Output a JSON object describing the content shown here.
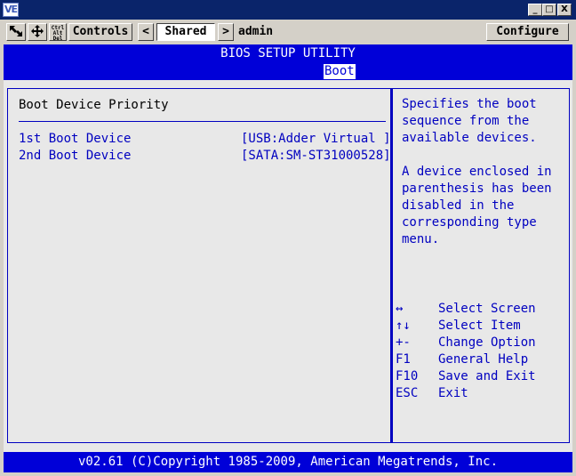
{
  "window": {
    "app_icon": "VE",
    "minimize": "_",
    "maximize": "□",
    "close": "X"
  },
  "toolbar": {
    "icons": [
      "cursor-arrows-icon",
      "move-icon",
      "ctrl-alt-del-icon"
    ],
    "ctrl_alt_del": [
      "Ctrl",
      "Alt",
      "Del"
    ],
    "controls_label": "Controls",
    "prev": "<",
    "shared_label": "Shared",
    "next": ">",
    "user": "admin",
    "configure_label": "Configure"
  },
  "bios": {
    "header": "BIOS SETUP UTILITY",
    "active_tab": "Boot",
    "section_title": "Boot Device Priority",
    "items": [
      {
        "name": "1st Boot Device",
        "value": "[USB:Adder Virtual ]"
      },
      {
        "name": "2nd Boot Device",
        "value": "[SATA:SM-ST31000528]"
      }
    ],
    "help_text": "Specifies the boot\nsequence from the\navailable devices.\n\nA device enclosed in\nparenthesis has been\ndisabled in the\ncorresponding type\nmenu.",
    "keys": [
      {
        "key": "↔",
        "desc": "Select Screen"
      },
      {
        "key": "↑↓",
        "desc": "Select Item"
      },
      {
        "key": "+-",
        "desc": "Change Option"
      },
      {
        "key": "F1",
        "desc": "General Help"
      },
      {
        "key": "F10",
        "desc": "Save and Exit"
      },
      {
        "key": "ESC",
        "desc": "Exit"
      }
    ],
    "footer": "v02.61 (C)Copyright 1985-2009, American Megatrends, Inc."
  },
  "colors": {
    "bios_blue": "#0000d8",
    "bios_text_blue": "#0000c0",
    "bios_background": "#e8e8e8",
    "title_bar": "#0a246a"
  }
}
